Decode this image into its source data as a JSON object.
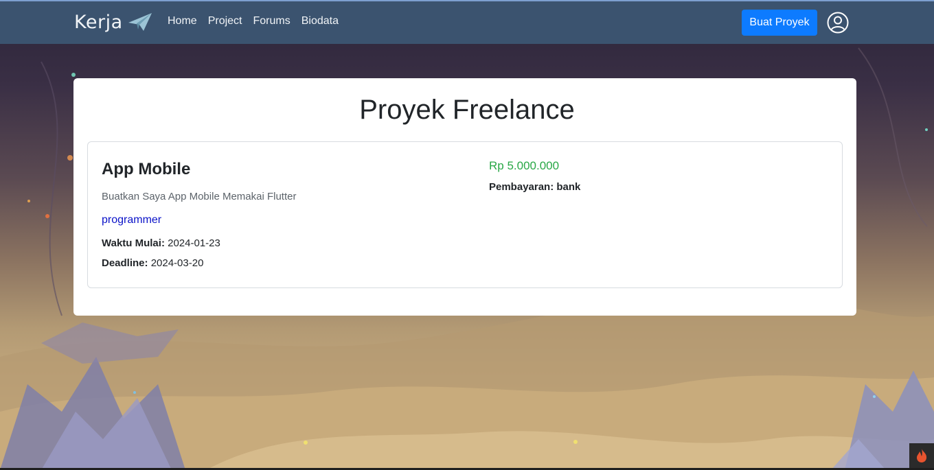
{
  "navbar": {
    "brand": "Kerja",
    "links": [
      "Home",
      "Project",
      "Forums",
      "Biodata"
    ],
    "create_button": "Buat Proyek"
  },
  "page": {
    "title": "Proyek Freelance"
  },
  "project": {
    "title": "App Mobile",
    "description": "Buatkan Saya App Mobile Memakai Flutter",
    "category": "programmer",
    "start_label": "Waktu Mulai:",
    "start_value": "2024-01-23",
    "deadline_label": "Deadline:",
    "deadline_value": "2024-03-20",
    "price": "Rp 5.000.000",
    "payment_label": "Pembayaran:",
    "payment_value": "bank"
  },
  "colors": {
    "navbar": "#3b536f",
    "primary_button": "#0d7bff",
    "price": "#28a745",
    "category_link": "#0a12c8"
  },
  "icons": [
    "paper-plane-icon",
    "user-circle-icon",
    "flame-icon"
  ]
}
